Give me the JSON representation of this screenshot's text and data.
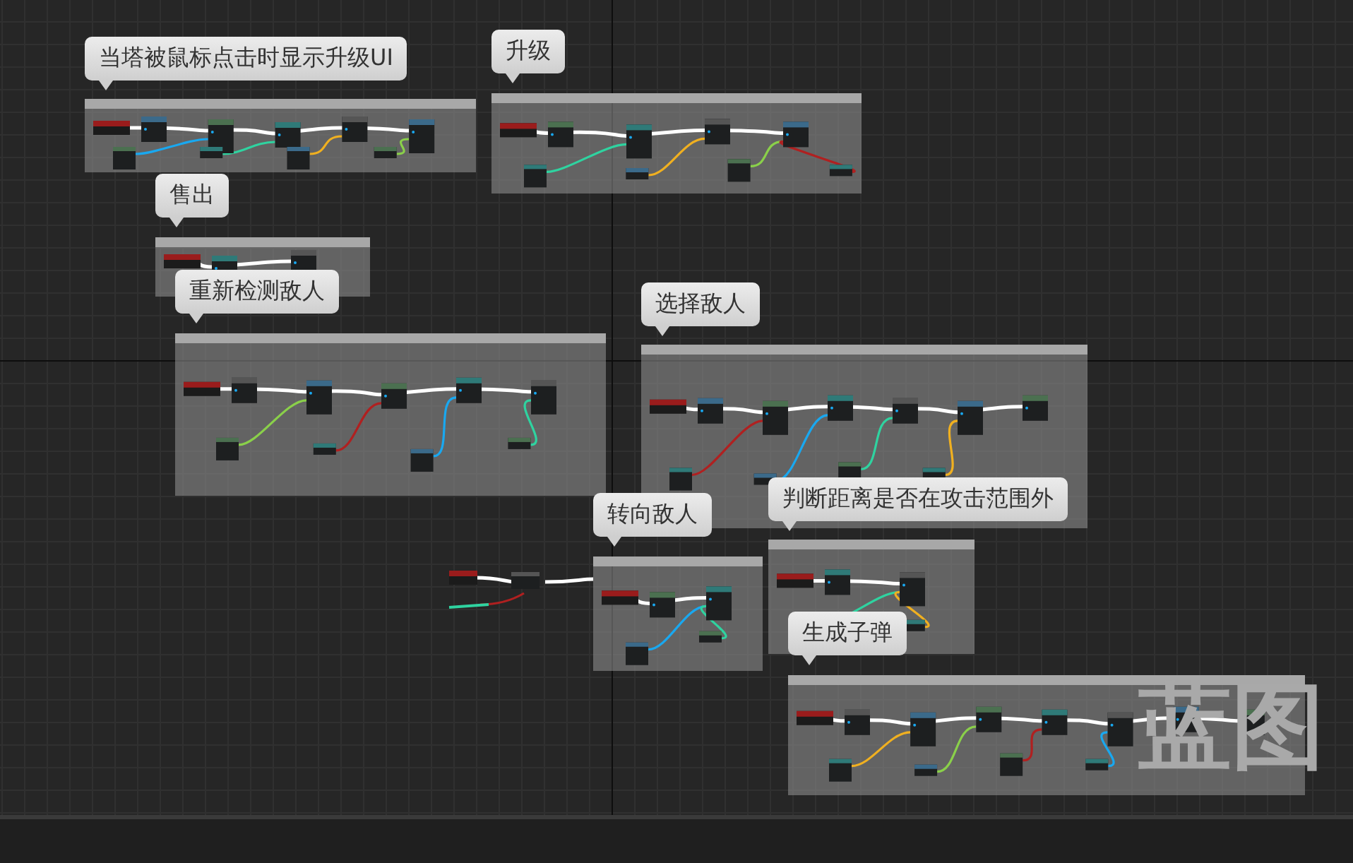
{
  "graph": {
    "comments": [
      {
        "title": "当塔被鼠标点击时显示升级UI"
      },
      {
        "title": "升级"
      },
      {
        "title": "售出"
      },
      {
        "title": "重新检测敌人"
      },
      {
        "title": "选择敌人"
      },
      {
        "title": "转向敌人"
      },
      {
        "title": "判断距离是否在攻击范围外"
      },
      {
        "title": "生成子弹"
      }
    ]
  },
  "graph_type_label": "蓝图"
}
